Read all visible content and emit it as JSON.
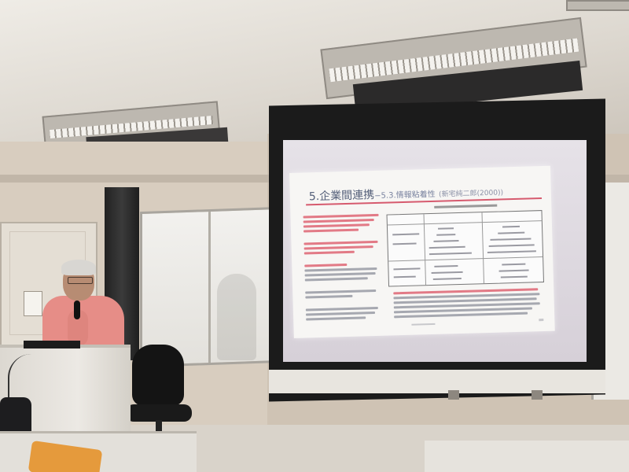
{
  "scene": {
    "description_colors": {
      "wall": "#d8cdbf",
      "ceiling": "#e8e4de",
      "screen_frame": "#1b1b1b",
      "slide_accent": "#d65a6e",
      "slide_title": "#55607a",
      "presenter_shirt": "#e68d87"
    }
  },
  "slide": {
    "title_main": "5.企業間連携",
    "title_sub": "−5.3.情報粘着性",
    "title_cite": "(新宅純二郎(2000))"
  }
}
